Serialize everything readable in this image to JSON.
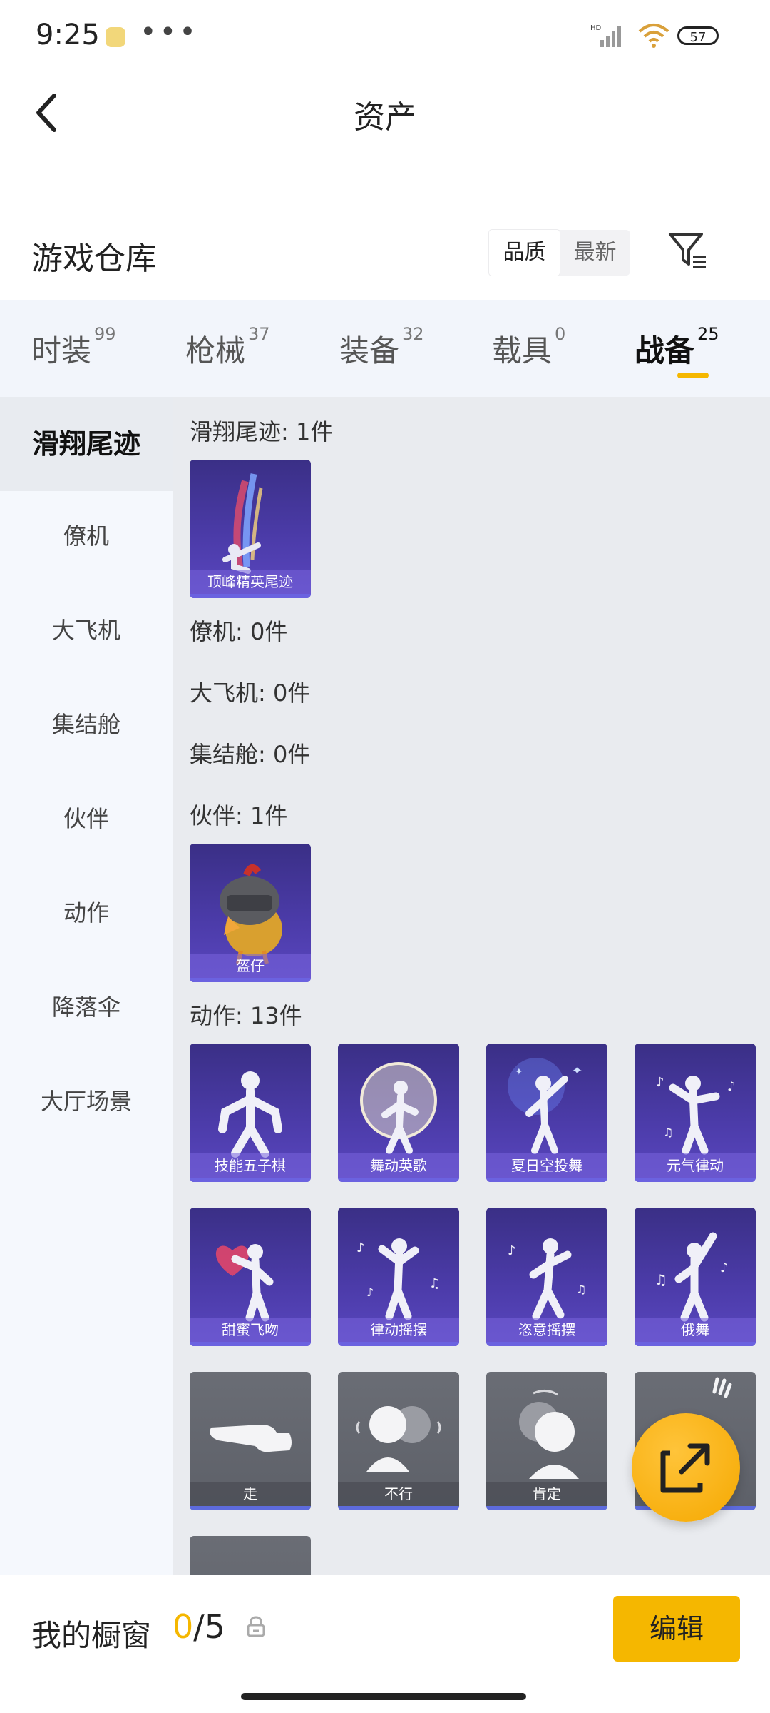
{
  "status_bar": {
    "time": "9:25",
    "dots": "•••",
    "battery": "57",
    "network": "HD"
  },
  "nav": {
    "title": "资产"
  },
  "warehouse": {
    "title": "游戏仓库",
    "sort": {
      "active": "品质",
      "inactive": "最新"
    }
  },
  "tabs": [
    {
      "label": "时装",
      "count": "99"
    },
    {
      "label": "枪械",
      "count": "37"
    },
    {
      "label": "装备",
      "count": "32"
    },
    {
      "label": "载具",
      "count": "0"
    },
    {
      "label": "战备",
      "count": "25"
    }
  ],
  "active_tab": "战备",
  "sidebar": {
    "items": [
      "滑翔尾迹",
      "僚机",
      "大飞机",
      "集结舱",
      "伙伴",
      "动作",
      "降落伞",
      "大厅场景"
    ]
  },
  "sections": {
    "glide": {
      "header": "滑翔尾迹: 1件",
      "items": [
        "顶峰精英尾迹"
      ]
    },
    "wingman": {
      "header": "僚机: 0件"
    },
    "plane": {
      "header": "大飞机: 0件"
    },
    "pod": {
      "header": "集结舱: 0件"
    },
    "partner": {
      "header": "伙伴: 1件",
      "items": [
        "盔仔"
      ]
    },
    "emote": {
      "header": "动作: 13件",
      "items": [
        "技能五子棋",
        "舞动英歌",
        "夏日空投舞",
        "元气律动",
        "甜蜜飞吻",
        "律动摇摆",
        "恣意摇摆",
        "俄舞",
        "走",
        "不行",
        "肯定"
      ]
    }
  },
  "bottom": {
    "label": "我的橱窗",
    "count_current": "0",
    "count_rest": "/5",
    "edit": "编辑"
  },
  "colors": {
    "accent": "#f5b700",
    "card_purple": "#4b3ba8",
    "card_grey": "#62656d"
  }
}
